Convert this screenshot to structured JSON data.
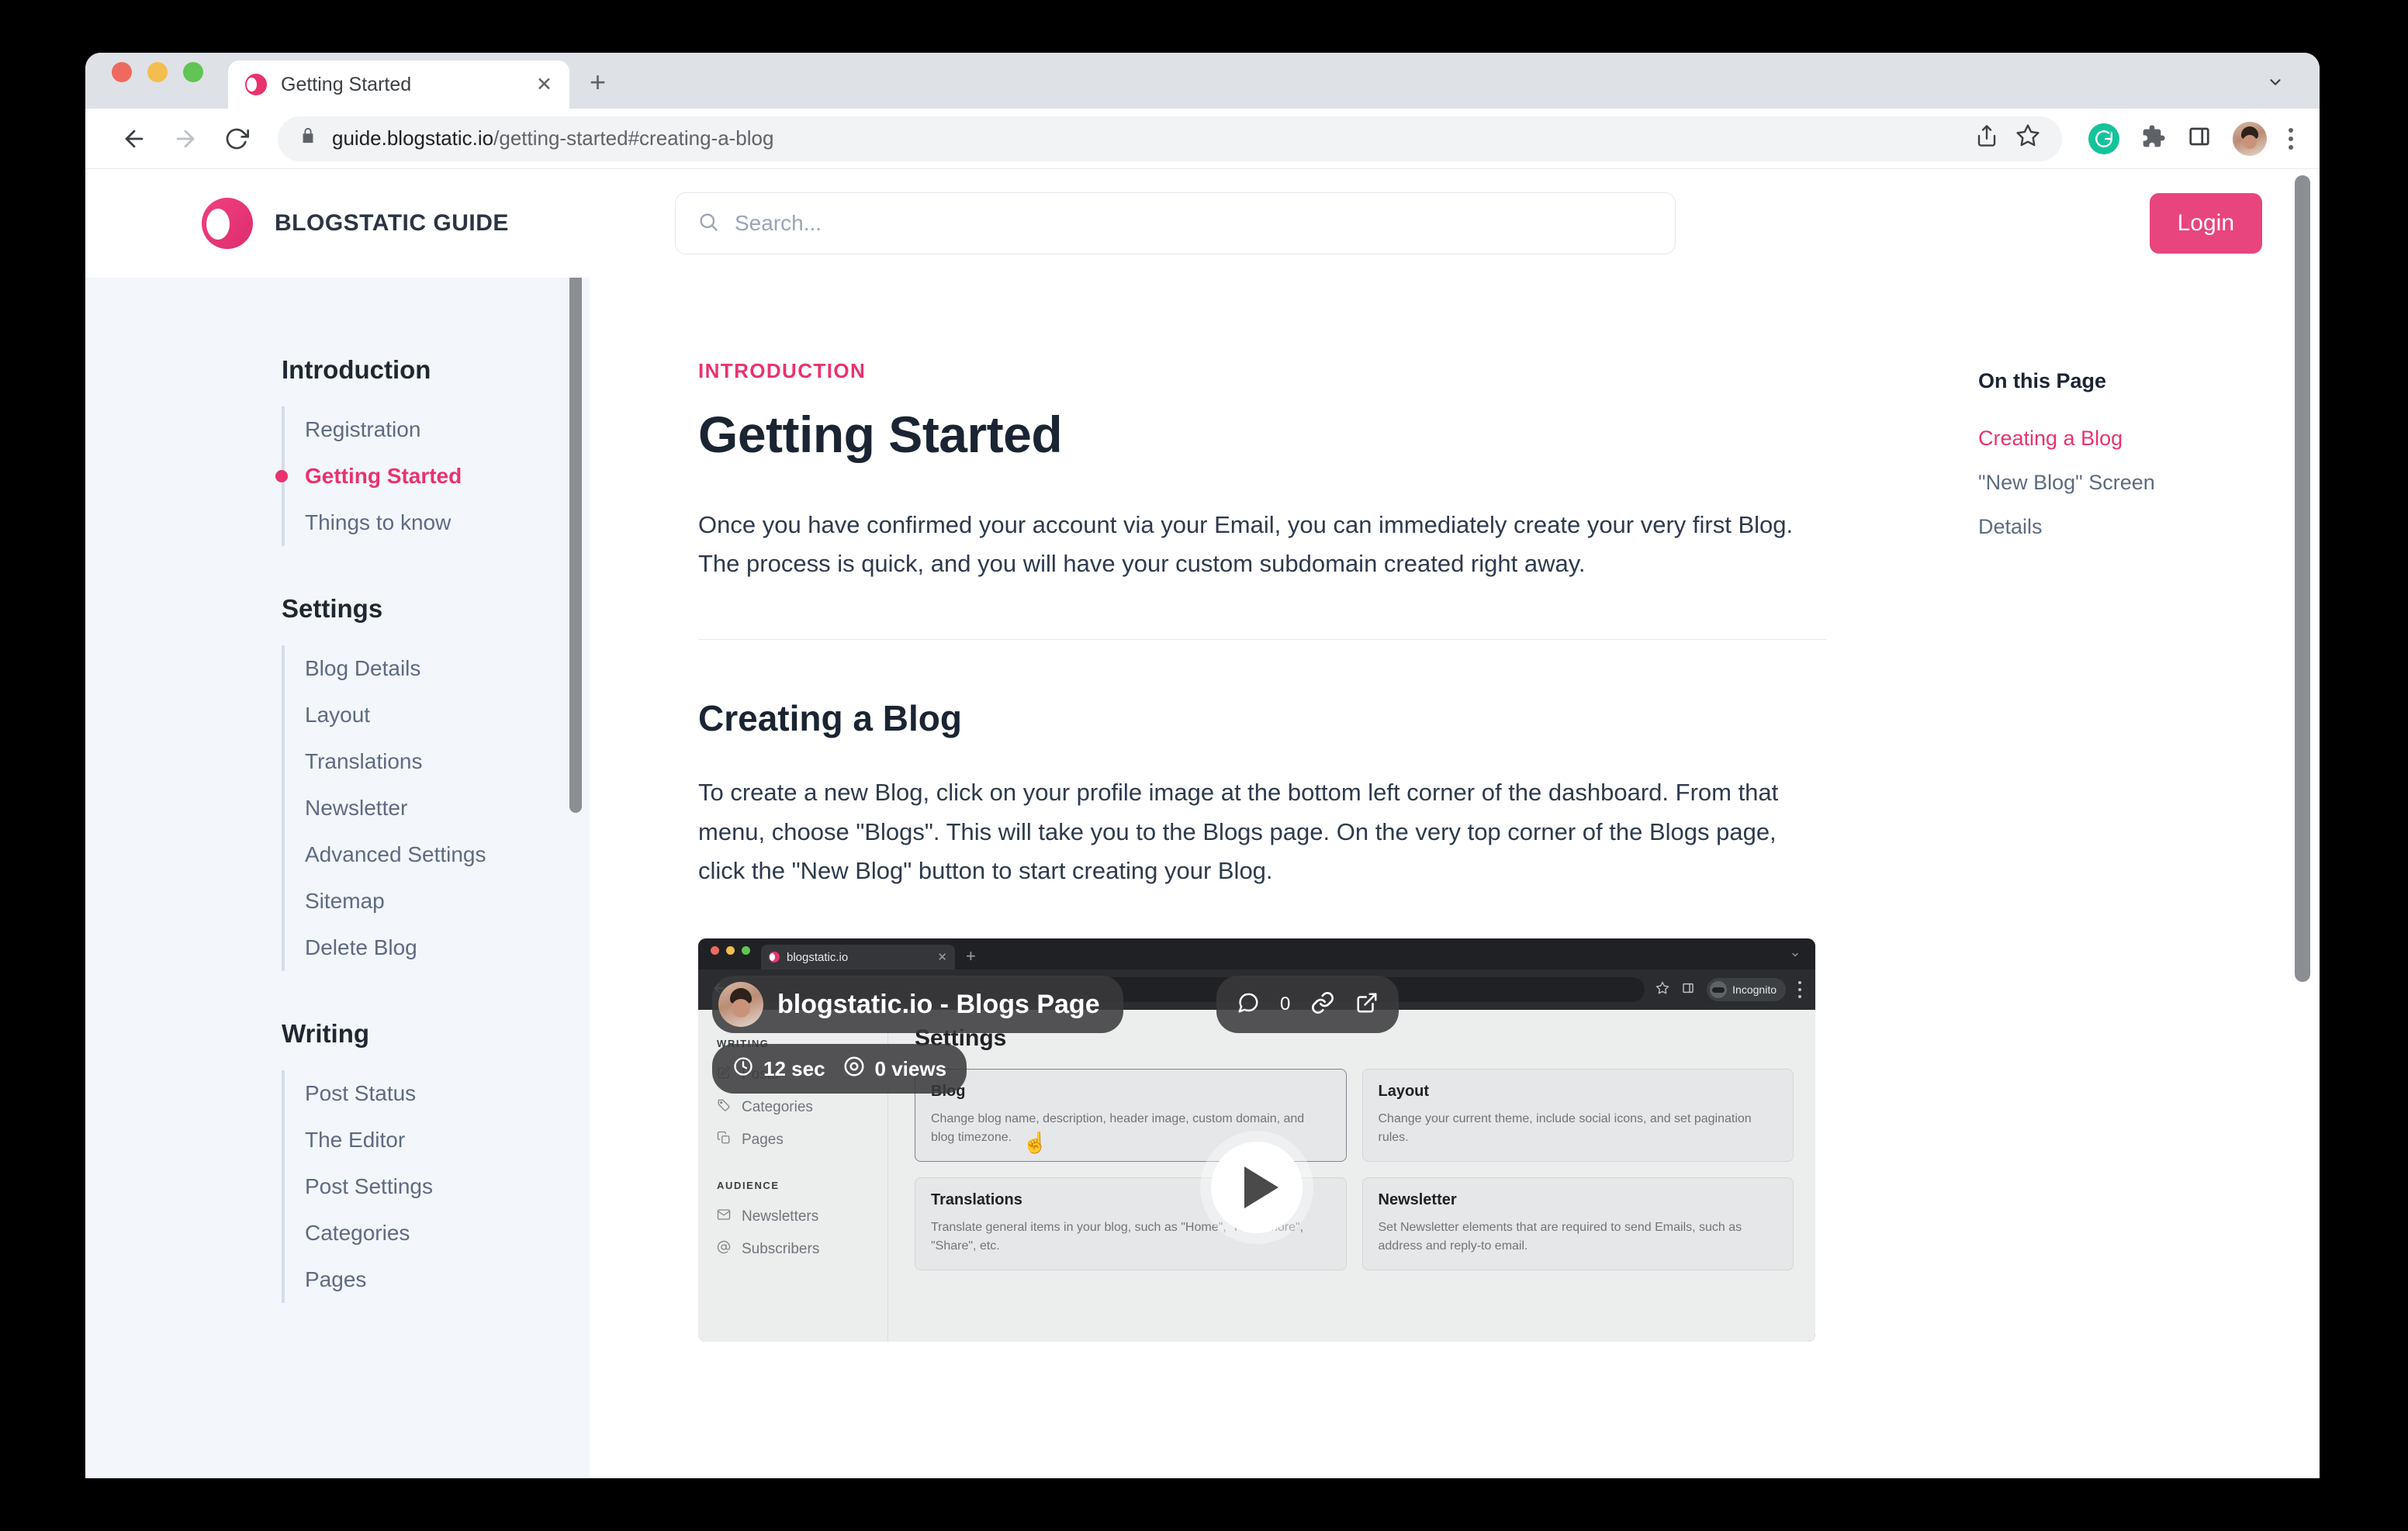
{
  "browser": {
    "tab": {
      "title": "Getting Started",
      "favicon": "blogstatic-logo-icon",
      "close": "✕"
    },
    "newtab_label": "+",
    "url": {
      "secure_icon": "lock-icon",
      "domain": "guide.blogstatic.io",
      "path": "/getting-started#creating-a-blog"
    },
    "toolbar_icons": [
      "share-icon",
      "bookmark-star-icon",
      "grammarly-icon",
      "extensions-puzzle-icon",
      "side-panel-icon",
      "profile-avatar",
      "chrome-menu-icon"
    ]
  },
  "header": {
    "brand_name": "BLOGSTATIC GUIDE",
    "search_placeholder": "Search...",
    "search_value": "",
    "login_label": "Login",
    "accent_color": "#e8336e"
  },
  "sidebar": {
    "groups": [
      {
        "title": "Introduction",
        "items": [
          {
            "label": "Registration",
            "active": false
          },
          {
            "label": "Getting Started",
            "active": true
          },
          {
            "label": "Things to know",
            "active": false
          }
        ]
      },
      {
        "title": "Settings",
        "items": [
          {
            "label": "Blog Details",
            "active": false
          },
          {
            "label": "Layout",
            "active": false
          },
          {
            "label": "Translations",
            "active": false
          },
          {
            "label": "Newsletter",
            "active": false
          },
          {
            "label": "Advanced Settings",
            "active": false
          },
          {
            "label": "Sitemap",
            "active": false
          },
          {
            "label": "Delete Blog",
            "active": false
          }
        ]
      },
      {
        "title": "Writing",
        "items": [
          {
            "label": "Post Status",
            "active": false
          },
          {
            "label": "The Editor",
            "active": false
          },
          {
            "label": "Post Settings",
            "active": false
          },
          {
            "label": "Categories",
            "active": false
          },
          {
            "label": "Pages",
            "active": false
          }
        ]
      }
    ]
  },
  "main": {
    "eyebrow": "INTRODUCTION",
    "title": "Getting Started",
    "lead": "Once you have confirmed your account via your Email, you can immediately create your very first Blog. The process is quick, and you will have your custom subdomain created right away.",
    "section_title": "Creating a Blog",
    "section_para": "To create a new Blog, click on your profile image at the bottom left corner of the dashboard. From that menu, choose \"Blogs\". This will take you to the Blogs page. On the very top corner of the Blogs page, click the \"New Blog\" button to start creating your Blog."
  },
  "toc": {
    "heading": "On this Page",
    "items": [
      {
        "label": "Creating a Blog",
        "active": true
      },
      {
        "label": "\"New Blog\" Screen",
        "active": false
      },
      {
        "label": "Details",
        "active": false
      }
    ]
  },
  "video": {
    "overlay_title": "blogstatic.io - Blogs Page",
    "comment_count": "0",
    "duration": "12 sec",
    "views": "0 views",
    "play_label": "play-button",
    "inner_browser": {
      "tab_title": "blogstatic.io",
      "tab_close": "✕",
      "newtab": "+",
      "profile_label": "Incognito"
    },
    "inner_page": {
      "heading": "Settings",
      "nav": [
        {
          "section": "WRITING",
          "items": [
            {
              "label": "Posts",
              "icon": "edit-square-icon"
            },
            {
              "label": "Categories",
              "icon": "tag-icon"
            },
            {
              "label": "Pages",
              "icon": "copy-pages-icon"
            }
          ]
        },
        {
          "section": "AUDIENCE",
          "items": [
            {
              "label": "Newsletters",
              "icon": "envelope-icon"
            },
            {
              "label": "Subscribers",
              "icon": "at-sign-icon"
            }
          ]
        }
      ],
      "cards": [
        {
          "title": "Blog",
          "desc": "Change blog name, description, header image, custom domain, and blog timezone.",
          "highlighted": true
        },
        {
          "title": "Layout",
          "desc": "Change your current theme, include social icons, and set pagination rules.",
          "highlighted": false
        },
        {
          "title": "Translations",
          "desc": "Translate general items in your blog, such as \"Home\", \"Read more\", \"Share\", etc.",
          "highlighted": false
        },
        {
          "title": "Newsletter",
          "desc": "Set Newsletter elements that are required to send Emails, such as address and reply-to email.",
          "highlighted": false
        }
      ]
    }
  }
}
